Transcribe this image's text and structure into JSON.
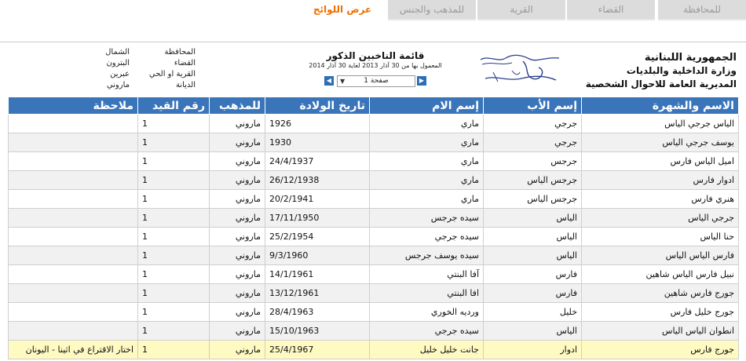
{
  "tabs": [
    "للمحافظة",
    "القضاء",
    "القرية",
    "للمذهب والجنس",
    "عرض اللوائح"
  ],
  "header": {
    "line1": "الجمهورية اللبنانية",
    "line2": "وزارة الداخلية والبلديات",
    "line3": "المديرية العامة للاحوال الشخصية"
  },
  "center": {
    "title": "قائمة الناخبين الذكور",
    "subtitle": "المعمول بها من 30 آذار 2013 لغاية 30 آذار 2014",
    "page_label": "صفحة 1"
  },
  "location": [
    {
      "label": "المحافظة",
      "value": "الشمال"
    },
    {
      "label": "القضاء",
      "value": "البترون"
    },
    {
      "label": "القرية او الحي",
      "value": "عبرين"
    },
    {
      "label": "الديانة",
      "value": "ماروني"
    }
  ],
  "table": {
    "columns": [
      "الاسم والشهرة",
      "إسم الأب",
      "إسم الام",
      "تاريخ الولادة",
      "للمذهب",
      "رقم القيد",
      "ملاحظة"
    ],
    "rows": [
      [
        "الياس جرجي الياس",
        "جرجي",
        "ماري",
        "1926",
        "ماروني",
        "1",
        ""
      ],
      [
        "يوسف جرجي الياس",
        "جرجي",
        "ماري",
        "1930",
        "ماروني",
        "1",
        ""
      ],
      [
        "اميل الياس فارس",
        "جرجس",
        "ماري",
        "24/4/1937",
        "ماروني",
        "1",
        ""
      ],
      [
        "ادوار فارس",
        "جرجس الياس",
        "ماري",
        "26/12/1938",
        "ماروني",
        "1",
        ""
      ],
      [
        "هنري فارس",
        "جرجس الياس",
        "ماري",
        "20/2/1941",
        "ماروني",
        "1",
        ""
      ],
      [
        "جرجي الياس",
        "الياس",
        "سيده جرجس",
        "17/11/1950",
        "ماروني",
        "1",
        ""
      ],
      [
        "حنا الياس",
        "الياس",
        "سيده جرجي",
        "25/2/1954",
        "ماروني",
        "1",
        ""
      ],
      [
        "فارس الياس الياس",
        "الياس",
        "سيده يوسف جرجس",
        "9/3/1960",
        "ماروني",
        "1",
        ""
      ],
      [
        "نبيل فارس الياس شاهين",
        "فارس",
        "آفا البنتي",
        "14/1/1961",
        "ماروني",
        "1",
        ""
      ],
      [
        "جورج فارس شاهين",
        "فارس",
        "افا البنتي",
        "13/12/1961",
        "ماروني",
        "1",
        ""
      ],
      [
        "جورج خليل فارس",
        "خليل",
        "ورديه الخوري",
        "28/4/1963",
        "ماروني",
        "1",
        ""
      ],
      [
        "انطوان الياس الياس",
        "الياس",
        "سيده جرجي",
        "15/10/1963",
        "ماروني",
        "1",
        ""
      ],
      [
        "جورج فارس",
        "ادوار",
        "جانت خليل خليل",
        "25/4/1967",
        "ماروني",
        "1",
        "اختار الاقتراع في اثينا - اليونان"
      ]
    ]
  },
  "colors": {
    "header_blue": "#3a75ba",
    "active_tab": "#ee6f00",
    "highlight_row": "#fff9c2"
  }
}
